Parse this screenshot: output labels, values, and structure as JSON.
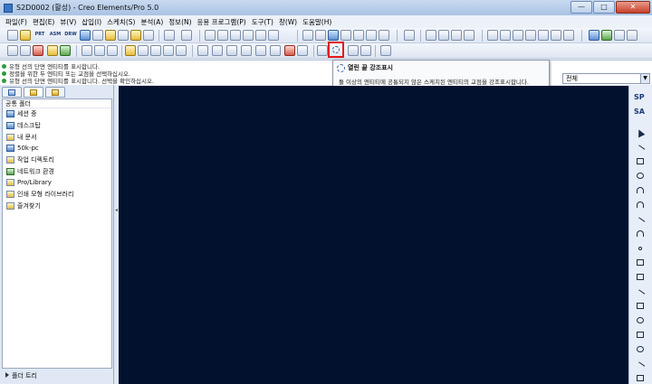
{
  "window": {
    "title": "S2D0002 (활성) - Creo Elements/Pro 5.0",
    "buttons": {
      "minimize": "—",
      "maximize": "□",
      "close": "✕"
    }
  },
  "menu": {
    "items": [
      "파일(F)",
      "편집(E)",
      "뷰(V)",
      "삽입(I)",
      "스케치(S)",
      "분석(A)",
      "정보(N)",
      "응용 프로그램(P)",
      "도구(T)",
      "창(W)",
      "도움말(H)"
    ]
  },
  "toolbar": {
    "text_buttons": [
      "PRT",
      "ASM",
      "DRW"
    ],
    "highlight_button": "highlight-open-ends-icon"
  },
  "messages": [
    "유형 선의 단면 엔티티를 표시합니다.",
    "정렬을 위한 두 엔티티 또는 교점을 선택하십시오.",
    "유형 선의 단면 엔티티를 표시합니다. 선택을 확인하십시오."
  ],
  "filter": {
    "value": "전체"
  },
  "tooltip": {
    "title": "열린 끝 강조표시",
    "description": "둘 이상의 엔티티에 공통되지 않은 스케치된 엔티티의 교점을 강조표시합니다."
  },
  "navigator": {
    "header": "공통 폴더",
    "items": [
      {
        "label": "세션 중",
        "icon": "session-icon"
      },
      {
        "label": "데스크탑",
        "icon": "desktop-icon"
      },
      {
        "label": "내 문서",
        "icon": "documents-icon"
      },
      {
        "label": "50k-pc",
        "icon": "computer-icon"
      },
      {
        "label": "작업 디렉토리",
        "icon": "working-dir-icon"
      },
      {
        "label": "네트워크 환경",
        "icon": "network-icon"
      },
      {
        "label": "Pro/Library",
        "icon": "library-icon"
      },
      {
        "label": "인쇄 모형 라이브러리",
        "icon": "model-library-icon"
      },
      {
        "label": "즐겨찾기",
        "icon": "favorites-icon"
      }
    ],
    "footer": "폴더 트리"
  },
  "right_toolbar": {
    "labels": [
      "SP",
      "SA"
    ]
  },
  "colors": {
    "canvas": "#02112e",
    "highlight": "#e21b1b"
  }
}
